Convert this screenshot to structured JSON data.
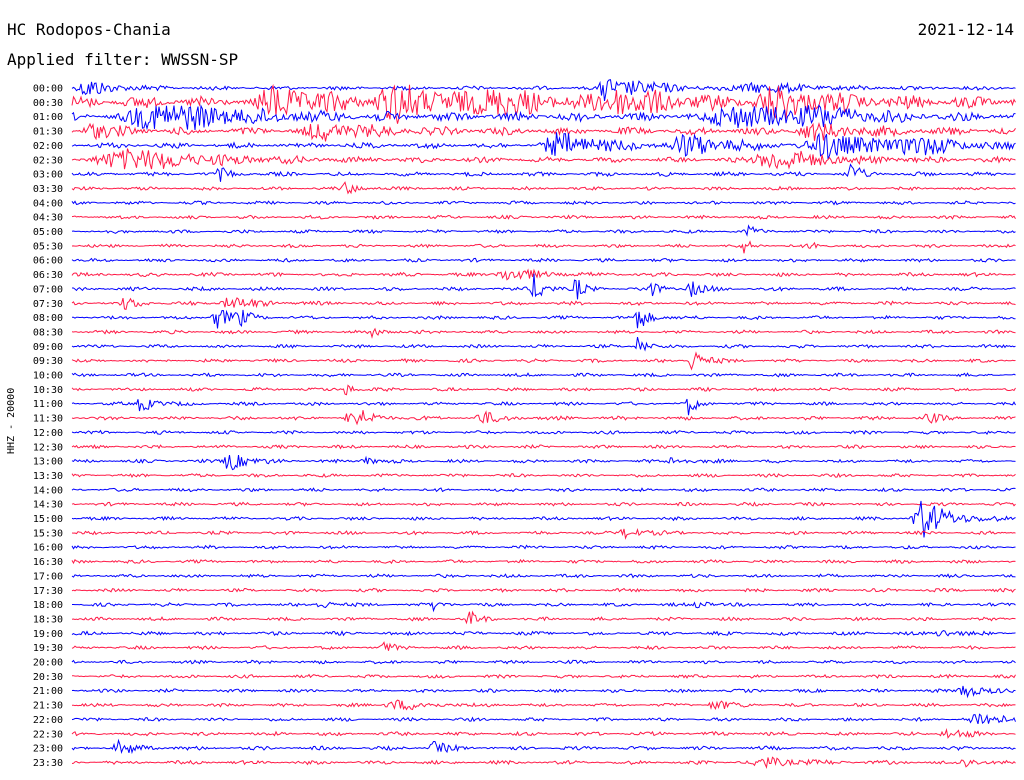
{
  "header": {
    "station": "HC Rodopos-Chania",
    "date": "2021-12-14",
    "filter_label": "Applied filter: WWSSN-SP"
  },
  "chart_data": {
    "type": "line",
    "title": "HC Rodopos-Chania",
    "channel_label": "HHZ - 20000",
    "x_unit": "minutes after the hour",
    "xlim": [
      0,
      30
    ],
    "colors": [
      "#0000ff",
      "#ff1a47"
    ],
    "rows": [
      {
        "time": "00:00",
        "noise": 2.2,
        "bursts": [
          {
            "at": 0.5,
            "amp": 9,
            "width": 0.8
          },
          {
            "at": 16.9,
            "amp": 17,
            "width": 0.3
          },
          {
            "at": 17.8,
            "amp": 7,
            "width": 1.2
          },
          {
            "at": 21.7,
            "amp": 5,
            "width": 1.5
          }
        ]
      },
      {
        "time": "00:30",
        "noise": 6.5,
        "bursts": [
          {
            "at": 6.5,
            "amp": 14,
            "width": 1.6
          },
          {
            "at": 10.3,
            "amp": 16,
            "width": 1.8
          },
          {
            "at": 13.3,
            "amp": 11,
            "width": 1.4
          },
          {
            "at": 17.3,
            "amp": 12,
            "width": 1.7
          },
          {
            "at": 22.3,
            "amp": 14,
            "width": 1.6
          }
        ]
      },
      {
        "time": "01:00",
        "noise": 4.5,
        "bursts": [
          {
            "at": 2.8,
            "amp": 14,
            "width": 2.6
          },
          {
            "at": 21.0,
            "amp": 12,
            "width": 1.8
          },
          {
            "at": 23.5,
            "amp": 9,
            "width": 1.5
          }
        ]
      },
      {
        "time": "01:30",
        "noise": 4.0,
        "bursts": [
          {
            "at": 0.6,
            "amp": 9,
            "width": 0.6
          },
          {
            "at": 8.0,
            "amp": 8,
            "width": 1.5
          },
          {
            "at": 23.5,
            "amp": 7,
            "width": 1.5
          }
        ]
      },
      {
        "time": "02:00",
        "noise": 3.0,
        "bursts": [
          {
            "at": 15.5,
            "amp": 12,
            "width": 1.4
          },
          {
            "at": 19.5,
            "amp": 10,
            "width": 1.4
          },
          {
            "at": 24.0,
            "amp": 13,
            "width": 1.5
          },
          {
            "at": 26.7,
            "amp": 9,
            "width": 1.2
          }
        ]
      },
      {
        "time": "02:30",
        "noise": 2.8,
        "bursts": [
          {
            "at": 1.8,
            "amp": 11,
            "width": 2.4
          },
          {
            "at": 22.3,
            "amp": 11,
            "width": 1.6
          }
        ]
      },
      {
        "time": "03:00",
        "noise": 2.2,
        "bursts": [
          {
            "at": 4.7,
            "amp": 6,
            "width": 0.3
          },
          {
            "at": 24.7,
            "amp": 12,
            "width": 0.3
          }
        ]
      },
      {
        "time": "03:30",
        "noise": 1.8,
        "bursts": [
          {
            "at": 8.7,
            "amp": 6,
            "width": 0.4
          }
        ]
      },
      {
        "time": "04:00",
        "noise": 1.8,
        "bursts": []
      },
      {
        "time": "04:30",
        "noise": 1.8,
        "bursts": []
      },
      {
        "time": "05:00",
        "noise": 1.8,
        "bursts": [
          {
            "at": 21.5,
            "amp": 5,
            "width": 0.3
          }
        ]
      },
      {
        "time": "05:30",
        "noise": 1.8,
        "bursts": [
          {
            "at": 21.3,
            "amp": 9,
            "width": 0.2
          },
          {
            "at": 23.5,
            "amp": 8,
            "width": 0.2
          }
        ]
      },
      {
        "time": "06:00",
        "noise": 1.8,
        "bursts": []
      },
      {
        "time": "06:30",
        "noise": 2.0,
        "bursts": [
          {
            "at": 13.8,
            "amp": 6,
            "width": 1.0
          }
        ]
      },
      {
        "time": "07:00",
        "noise": 2.0,
        "bursts": [
          {
            "at": 14.7,
            "amp": 16,
            "width": 0.3
          },
          {
            "at": 16.0,
            "amp": 13,
            "width": 0.2
          },
          {
            "at": 18.3,
            "amp": 9,
            "width": 0.3
          },
          {
            "at": 19.6,
            "amp": 10,
            "width": 0.3
          }
        ]
      },
      {
        "time": "07:30",
        "noise": 2.0,
        "bursts": [
          {
            "at": 1.7,
            "amp": 6,
            "width": 0.4
          },
          {
            "at": 5.0,
            "amp": 7,
            "width": 0.7
          }
        ]
      },
      {
        "time": "08:00",
        "noise": 1.8,
        "bursts": [
          {
            "at": 4.6,
            "amp": 12,
            "width": 0.4
          },
          {
            "at": 5.3,
            "amp": 8,
            "width": 0.3
          },
          {
            "at": 18.0,
            "amp": 14,
            "width": 0.3
          }
        ]
      },
      {
        "time": "08:30",
        "noise": 1.8,
        "bursts": [
          {
            "at": 9.5,
            "amp": 4,
            "width": 0.4
          }
        ]
      },
      {
        "time": "09:00",
        "noise": 1.8,
        "bursts": [
          {
            "at": 18.0,
            "amp": 14,
            "width": 0.2
          }
        ]
      },
      {
        "time": "09:30",
        "noise": 1.8,
        "bursts": [
          {
            "at": 19.7,
            "amp": 12,
            "width": 0.35
          }
        ]
      },
      {
        "time": "10:00",
        "noise": 1.8,
        "bursts": []
      },
      {
        "time": "10:30",
        "noise": 1.8,
        "bursts": [
          {
            "at": 8.7,
            "amp": 6,
            "width": 0.3
          }
        ]
      },
      {
        "time": "11:00",
        "noise": 1.8,
        "bursts": [
          {
            "at": 2.2,
            "amp": 10,
            "width": 0.35
          },
          {
            "at": 19.6,
            "amp": 12,
            "width": 0.2
          }
        ]
      },
      {
        "time": "11:30",
        "noise": 2.0,
        "bursts": [
          {
            "at": 8.9,
            "amp": 13,
            "width": 0.5
          },
          {
            "at": 13.0,
            "amp": 6,
            "width": 0.6
          },
          {
            "at": 27.2,
            "amp": 6,
            "width": 0.3
          }
        ]
      },
      {
        "time": "12:00",
        "noise": 1.8,
        "bursts": []
      },
      {
        "time": "12:30",
        "noise": 1.8,
        "bursts": []
      },
      {
        "time": "13:00",
        "noise": 1.8,
        "bursts": [
          {
            "at": 5.0,
            "amp": 11,
            "width": 0.5
          },
          {
            "at": 9.3,
            "amp": 5,
            "width": 0.3
          },
          {
            "at": 19.1,
            "amp": 5,
            "width": 0.4
          }
        ]
      },
      {
        "time": "13:30",
        "noise": 1.8,
        "bursts": []
      },
      {
        "time": "14:00",
        "noise": 1.8,
        "bursts": []
      },
      {
        "time": "14:30",
        "noise": 1.8,
        "bursts": []
      },
      {
        "time": "15:00",
        "noise": 1.8,
        "bursts": [
          {
            "at": 27.0,
            "amp": 20,
            "width": 0.8
          }
        ]
      },
      {
        "time": "15:30",
        "noise": 1.8,
        "bursts": [
          {
            "at": 17.6,
            "amp": 6,
            "width": 0.5
          }
        ]
      },
      {
        "time": "16:00",
        "noise": 1.8,
        "bursts": []
      },
      {
        "time": "16:30",
        "noise": 1.8,
        "bursts": []
      },
      {
        "time": "17:00",
        "noise": 1.8,
        "bursts": []
      },
      {
        "time": "17:30",
        "noise": 1.8,
        "bursts": []
      },
      {
        "time": "18:00",
        "noise": 1.8,
        "bursts": [
          {
            "at": 7.9,
            "amp": 6,
            "width": 0.3
          },
          {
            "at": 11.5,
            "amp": 5,
            "width": 0.3
          },
          {
            "at": 19.9,
            "amp": 5,
            "width": 0.3
          }
        ]
      },
      {
        "time": "18:30",
        "noise": 1.8,
        "bursts": [
          {
            "at": 12.6,
            "amp": 8,
            "width": 0.3
          }
        ]
      },
      {
        "time": "19:00",
        "noise": 2.0,
        "bursts": [
          {
            "at": 27.6,
            "amp": 5,
            "width": 0.4
          }
        ]
      },
      {
        "time": "19:30",
        "noise": 1.8,
        "bursts": [
          {
            "at": 9.9,
            "amp": 5,
            "width": 0.3
          }
        ]
      },
      {
        "time": "20:00",
        "noise": 1.8,
        "bursts": []
      },
      {
        "time": "20:30",
        "noise": 1.8,
        "bursts": []
      },
      {
        "time": "21:00",
        "noise": 1.8,
        "bursts": [
          {
            "at": 28.3,
            "amp": 9,
            "width": 0.45
          }
        ]
      },
      {
        "time": "21:30",
        "noise": 1.8,
        "bursts": [
          {
            "at": 10.3,
            "amp": 5,
            "width": 1.0
          },
          {
            "at": 20.4,
            "amp": 5,
            "width": 0.5
          }
        ]
      },
      {
        "time": "22:00",
        "noise": 1.8,
        "bursts": [
          {
            "at": 28.8,
            "amp": 7,
            "width": 1.0
          }
        ]
      },
      {
        "time": "22:30",
        "noise": 2.0,
        "bursts": [
          {
            "at": 27.8,
            "amp": 5,
            "width": 0.6
          }
        ]
      },
      {
        "time": "23:00",
        "noise": 2.0,
        "bursts": [
          {
            "at": 1.5,
            "amp": 7,
            "width": 0.5
          },
          {
            "at": 11.5,
            "amp": 6,
            "width": 0.4
          }
        ]
      },
      {
        "time": "23:30",
        "noise": 2.0,
        "bursts": [
          {
            "at": 22.0,
            "amp": 5,
            "width": 1.0
          },
          {
            "at": 28.4,
            "amp": 5,
            "width": 0.4
          }
        ]
      }
    ]
  }
}
